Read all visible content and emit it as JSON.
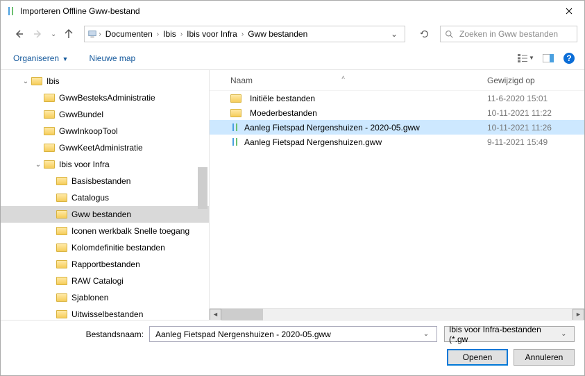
{
  "title": "Importeren Offline Gww-bestand",
  "breadcrumb": [
    "Documenten",
    "Ibis",
    "Ibis voor Infra",
    "Gww bestanden"
  ],
  "search_placeholder": "Zoeken in Gww bestanden",
  "toolbar": {
    "organize": "Organiseren",
    "new_folder": "Nieuwe map"
  },
  "tree": [
    {
      "depth": 0,
      "label": "Ibis",
      "expander": "⌄",
      "selected": false
    },
    {
      "depth": 1,
      "label": "GwwBesteksAdministratie",
      "expander": "",
      "selected": false
    },
    {
      "depth": 1,
      "label": "GwwBundel",
      "expander": "",
      "selected": false
    },
    {
      "depth": 1,
      "label": "GwwInkoopTool",
      "expander": "",
      "selected": false
    },
    {
      "depth": 1,
      "label": "GwwKeetAdministratie",
      "expander": "",
      "selected": false
    },
    {
      "depth": 1,
      "label": "Ibis voor Infra",
      "expander": "⌄",
      "selected": false
    },
    {
      "depth": 2,
      "label": "Basisbestanden",
      "expander": "",
      "selected": false
    },
    {
      "depth": 2,
      "label": "Catalogus",
      "expander": "",
      "selected": false
    },
    {
      "depth": 2,
      "label": "Gww bestanden",
      "expander": "",
      "selected": true
    },
    {
      "depth": 2,
      "label": "Iconen werkbalk Snelle toegang",
      "expander": "",
      "selected": false
    },
    {
      "depth": 2,
      "label": "Kolomdefinitie bestanden",
      "expander": "",
      "selected": false
    },
    {
      "depth": 2,
      "label": "Rapportbestanden",
      "expander": "",
      "selected": false
    },
    {
      "depth": 2,
      "label": "RAW Catalogi",
      "expander": "",
      "selected": false
    },
    {
      "depth": 2,
      "label": "Sjablonen",
      "expander": "",
      "selected": false
    },
    {
      "depth": 2,
      "label": "Uitwisselbestanden",
      "expander": "",
      "selected": false
    }
  ],
  "columns": {
    "name": "Naam",
    "modified": "Gewijzigd op"
  },
  "files": [
    {
      "kind": "folder",
      "name": "Initiële bestanden",
      "date": "11-6-2020 15:01",
      "selected": false
    },
    {
      "kind": "folder",
      "name": "Moederbestanden",
      "date": "10-11-2021 11:22",
      "selected": false
    },
    {
      "kind": "file",
      "name": "Aanleg Fietspad Nergenshuizen - 2020-05.gww",
      "date": "10-11-2021 11:26",
      "selected": true
    },
    {
      "kind": "file",
      "name": "Aanleg Fietspad Nergenshuizen.gww",
      "date": "9-11-2021 15:49",
      "selected": false
    }
  ],
  "footer": {
    "filename_label": "Bestandsnaam:",
    "filename_value": "Aanleg Fietspad Nergenshuizen - 2020-05.gww",
    "filter": "Ibis voor Infra-bestanden (*.gw",
    "open": "Openen",
    "cancel": "Annuleren"
  }
}
